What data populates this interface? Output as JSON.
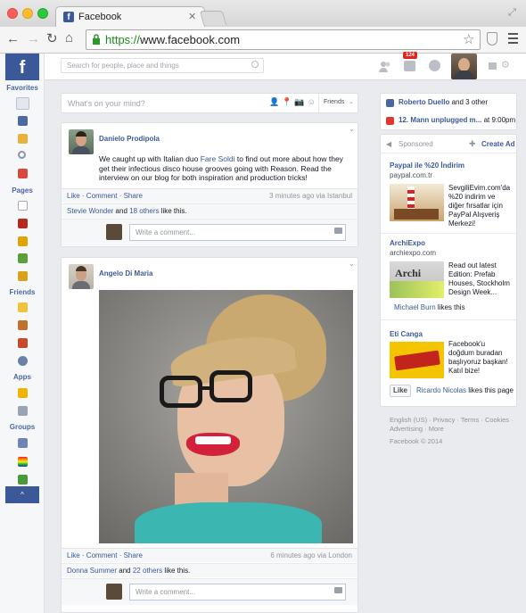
{
  "browser": {
    "tab_title": "Facebook",
    "url_scheme": "https://",
    "url_rest": "www.facebook.com"
  },
  "header": {
    "search_placeholder": "Search for people, place and things",
    "notification_count": "124"
  },
  "leftnav": {
    "favorites": "Favorites",
    "pages": "Pages",
    "friends": "Friends",
    "apps": "Apps",
    "groups": "Groups"
  },
  "composer": {
    "placeholder": "What's on your mind?",
    "audience": "Friends"
  },
  "posts": [
    {
      "author": "Danielo Prodipola",
      "text_before": "We caught up with Italian duo ",
      "text_link": "Fare Soldi",
      "text_after": " to find out more about how they get their infectious disco house grooves going with Reason. Read the interview on our blog for both inspiration and production tricks!",
      "like": "Like",
      "comment": "Comment",
      "share": "Share",
      "time": "3 minutes ago via Istanbul",
      "liker": "Stevie Wonder",
      "and": " and ",
      "others": "18 others",
      "likes_suffix": " like this.",
      "comment_placeholder": "Write a comment..."
    },
    {
      "author": "Angelo Di Maria",
      "like": "Like",
      "comment": "Comment",
      "share": "Share",
      "time": "6 minutes ago via London",
      "liker": "Donna Summer",
      "and": " and ",
      "others": "22 others",
      "likes_suffix": " like this.",
      "comment_placeholder": "Write a comment..."
    }
  ],
  "sidebar": {
    "activity1_name": "Roberto Duello",
    "activity1_rest": " and 3 other",
    "activity2_name": "12. Mann unplugged m...",
    "activity2_time": " at 9:00pm",
    "sponsored": "Sponsored",
    "create_ad": "Create Ad",
    "ads": [
      {
        "title": "Paypal ile %20 İndirim",
        "domain": "paypal.com.tr",
        "desc": "SevgiliEvim.com'da %20 indirim ve diğer fırsatlar için PayPal Alışveriş Merkezi!"
      },
      {
        "title": "ArchiExpo",
        "domain": "archiexpo.com",
        "desc": "Read out latest Edition: Prefab Houses, Stockholm Design Week...",
        "social": "Michael Burn",
        "social_suffix": " likes this"
      },
      {
        "title": "Eti Canga",
        "desc": "Facebook'u doğdum buradan başlıyoruz başkan! Katıl bize!",
        "like_btn": "Like",
        "social": "Ricardo Nicolas",
        "social_suffix": " likes this page"
      }
    ],
    "footer1": "English (US) · Privacy · Terms · Cookies ·",
    "footer2": "Advertising · More",
    "copyright": "Facebook © 2014"
  },
  "colors": {
    "brand": "#3b5998",
    "lightbg": "#e9ebee"
  }
}
